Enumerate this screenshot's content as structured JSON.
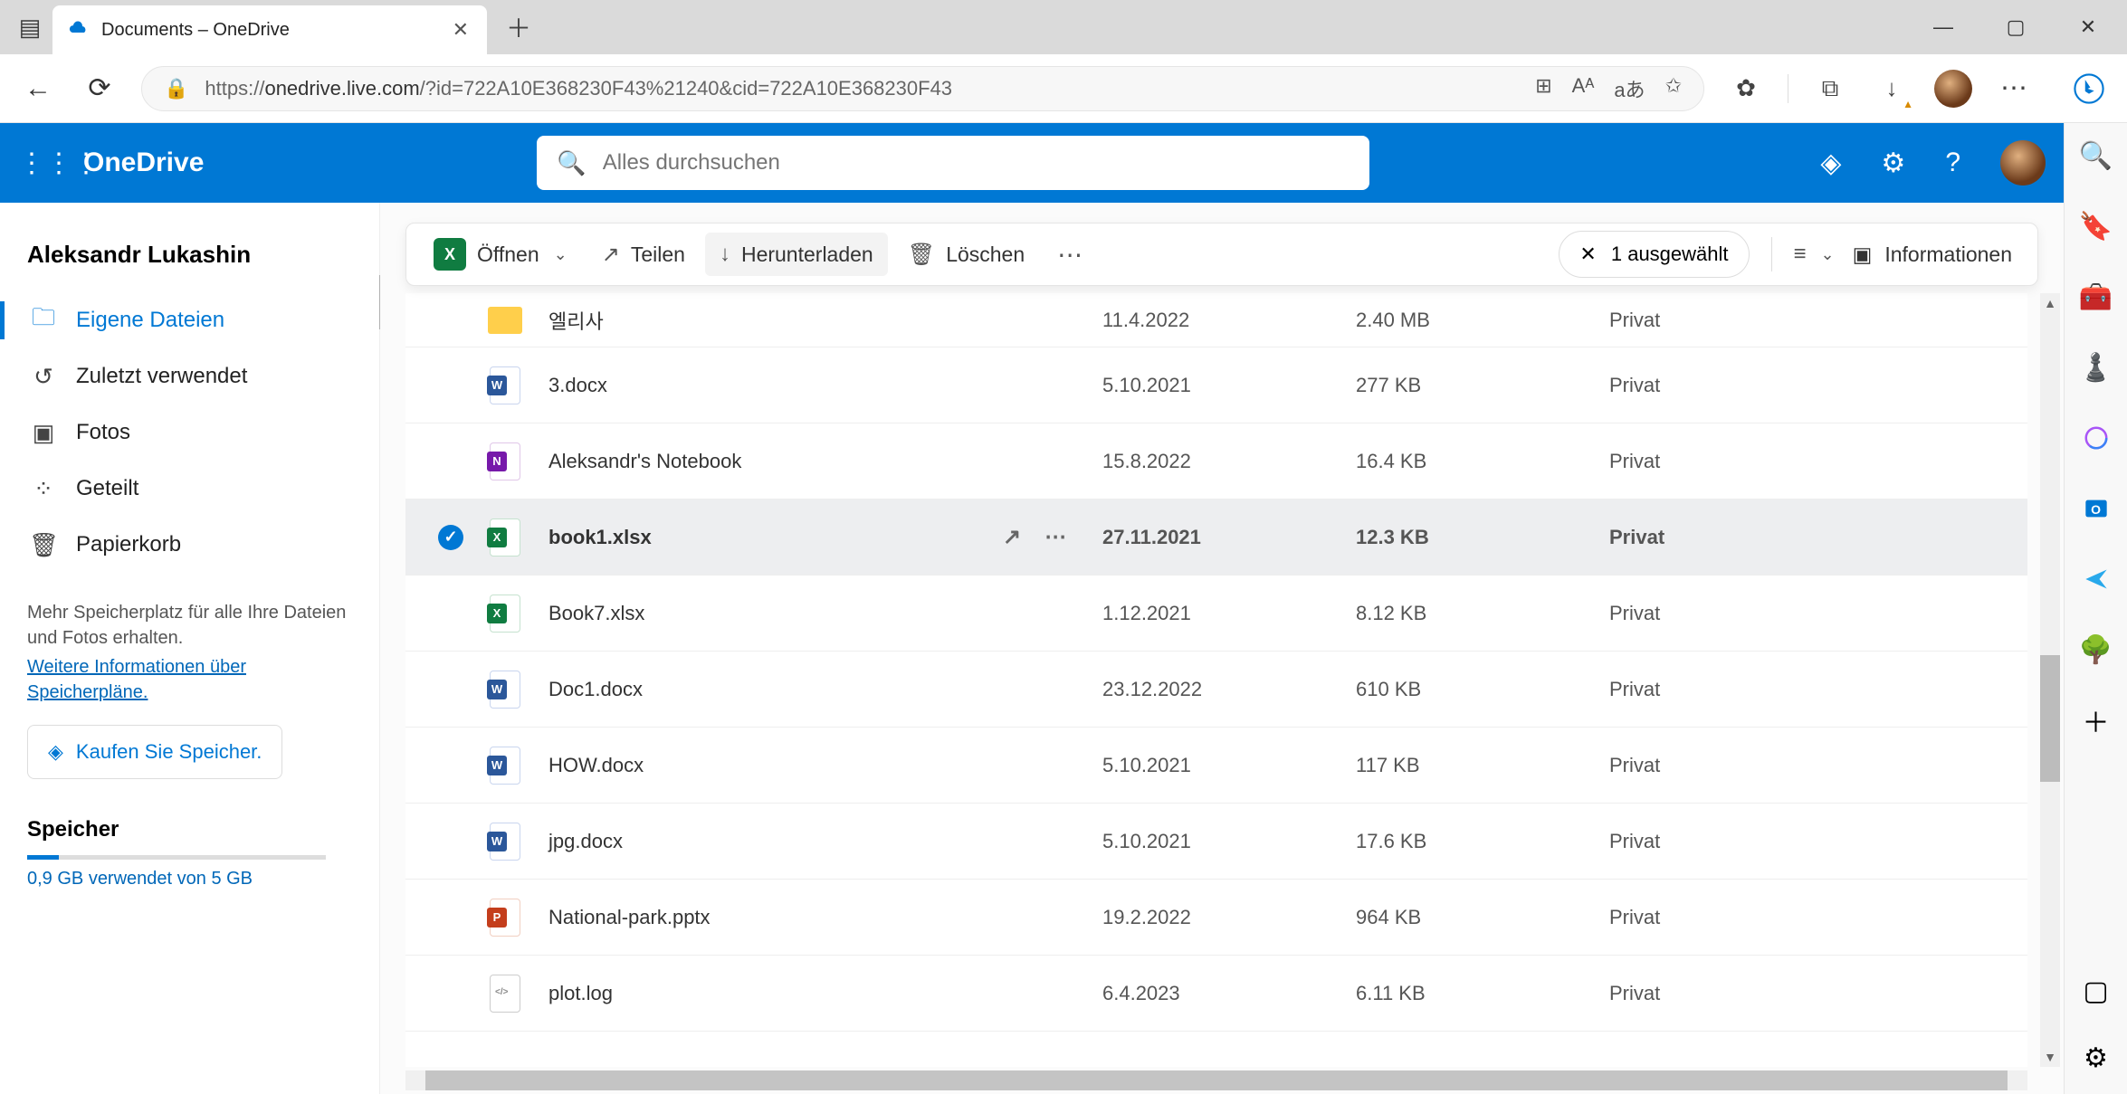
{
  "browser": {
    "tab_title": "Documents – OneDrive",
    "url_prefix": "https://",
    "url_host": "onedrive.live.com",
    "url_path": "/?id=722A10E368230F43%21240&cid=722A10E368230F43"
  },
  "suite": {
    "brand": "OneDrive",
    "search_placeholder": "Alles durchsuchen"
  },
  "user": {
    "name": "Aleksandr Lukashin"
  },
  "sidebar": {
    "items": [
      {
        "label": "Eigene Dateien",
        "icon": "🗀"
      },
      {
        "label": "Zuletzt verwendet",
        "icon": "↺"
      },
      {
        "label": "Fotos",
        "icon": "▣"
      },
      {
        "label": "Geteilt",
        "icon": "⌆"
      },
      {
        "label": "Papierkorb",
        "icon": "🗑"
      }
    ],
    "promo_line1": "Mehr Speicherplatz für alle Ihre Dateien und Fotos erhalten.",
    "promo_link": "Weitere Informationen über Speicherpläne.",
    "buy_label": "Kaufen Sie Speicher.",
    "storage_heading": "Speicher",
    "storage_text": "0,9 GB verwendet von 5 GB"
  },
  "cmdbar": {
    "open": "Öffnen",
    "share": "Teilen",
    "download": "Herunterladen",
    "delete": "Löschen",
    "selected": "1 ausgewählt",
    "info": "Informationen"
  },
  "files": [
    {
      "name": "엘리사",
      "date": "11.4.2022",
      "size": "2.40 MB",
      "sharing": "Privat",
      "type": "folder",
      "selected": false
    },
    {
      "name": "3.docx",
      "date": "5.10.2021",
      "size": "277 KB",
      "sharing": "Privat",
      "type": "word",
      "selected": false
    },
    {
      "name": "Aleksandr's Notebook",
      "date": "15.8.2022",
      "size": "16.4 KB",
      "sharing": "Privat",
      "type": "onenote",
      "selected": false
    },
    {
      "name": "book1.xlsx",
      "date": "27.11.2021",
      "size": "12.3 KB",
      "sharing": "Privat",
      "type": "excel",
      "selected": true
    },
    {
      "name": "Book7.xlsx",
      "date": "1.12.2021",
      "size": "8.12 KB",
      "sharing": "Privat",
      "type": "excel",
      "selected": false
    },
    {
      "name": "Doc1.docx",
      "date": "23.12.2022",
      "size": "610 KB",
      "sharing": "Privat",
      "type": "word",
      "selected": false
    },
    {
      "name": "HOW.docx",
      "date": "5.10.2021",
      "size": "117 KB",
      "sharing": "Privat",
      "type": "word",
      "selected": false
    },
    {
      "name": "jpg.docx",
      "date": "5.10.2021",
      "size": "17.6 KB",
      "sharing": "Privat",
      "type": "word",
      "selected": false
    },
    {
      "name": "National-park.pptx",
      "date": "19.2.2022",
      "size": "964 KB",
      "sharing": "Privat",
      "type": "ppt",
      "selected": false
    },
    {
      "name": "plot.log",
      "date": "6.4.2023",
      "size": "6.11 KB",
      "sharing": "Privat",
      "type": "generic",
      "selected": false
    }
  ]
}
